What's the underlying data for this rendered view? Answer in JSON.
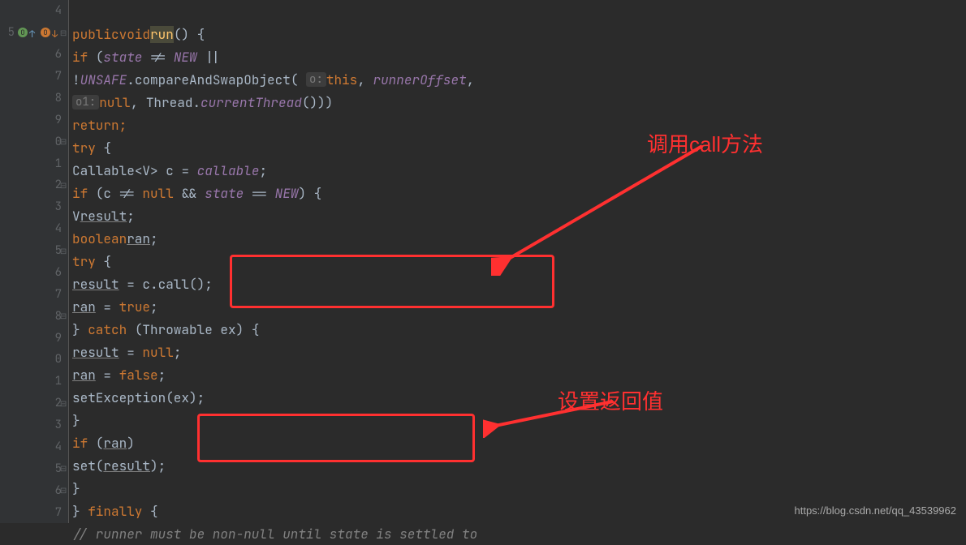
{
  "gutter": {
    "lines": [
      "4",
      "5",
      "6",
      "7",
      "8",
      "9",
      "0",
      "1",
      "2",
      "3",
      "4",
      "5",
      "6",
      "7",
      "8",
      "9",
      "0",
      "1",
      "2",
      "3",
      "4",
      "5",
      "6",
      "7"
    ]
  },
  "code": {
    "l1": "",
    "l2_public": "public",
    "l2_void": "void",
    "l2_run": "run",
    "l2_paren": "() {",
    "l3_if": "if",
    "l3_state": "state",
    "l3_ne": " != ",
    "l3_new": "NEW",
    "l3_or": " ||",
    "l4_bang": "!",
    "l4_unsafe": "UNSAFE",
    "l4_dot": ".",
    "l4_cas": "compareAndSwapObject",
    "l4_open": "( ",
    "l4_hint_o": "o:",
    "l4_this": "this",
    "l4_comma": ", ",
    "l4_runner": "runnerOffset",
    "l4_comma2": ",",
    "l5_hint_o1": "o1:",
    "l5_null": "null",
    "l5_thread": "Thread",
    "l5_curr": "currentThread",
    "l5_close": "()))",
    "l6_return": "return;",
    "l7_try": "try",
    "l7_brace": " {",
    "l8_callable": "Callable",
    "l8_v": "V",
    "l8_c": " c = ",
    "l8_field": "callable",
    "l8_semi": ";",
    "l9_if": "if",
    "l9_cond": " (c != ",
    "l9_null": "null",
    "l9_and": " && ",
    "l9_state": "state",
    "l9_eq": " == ",
    "l9_new": "NEW",
    "l9_brace": ") {",
    "l10_v": "V",
    "l10_result": "result",
    "l10_semi": ";",
    "l11_bool": "boolean",
    "l11_ran": "ran",
    "l11_semi": ";",
    "l12_try": "try",
    "l12_brace": " {",
    "l13_result": "result",
    "l13_assign": " = c.call();",
    "l14_ran": "ran",
    "l14_assign": " = ",
    "l14_true": "true",
    "l14_semi": ";",
    "l15_close": "} ",
    "l15_catch": "catch",
    "l15_throw": " (Throwable ex) {",
    "l16_result": "result",
    "l16_assign": " = ",
    "l16_null": "null",
    "l16_semi": ";",
    "l17_ran": "ran",
    "l17_assign": " = ",
    "l17_false": "false",
    "l17_semi": ";",
    "l18_setex": "setException(ex);",
    "l19_close": "}",
    "l20_if": "if",
    "l20_open": " (",
    "l20_ran": "ran",
    "l20_close": ")",
    "l21_set": "set(",
    "l21_result": "result",
    "l21_close": ");",
    "l22_close": "}",
    "l23_close": "} ",
    "l23_finally": "finally",
    "l23_brace": " {",
    "l24_comment": "// runner must be non-null until state is settled to"
  },
  "annotations": {
    "call_label": "调用call方法",
    "set_label": "设置返回值"
  },
  "watermark": "https://blog.csdn.net/qq_43539962"
}
